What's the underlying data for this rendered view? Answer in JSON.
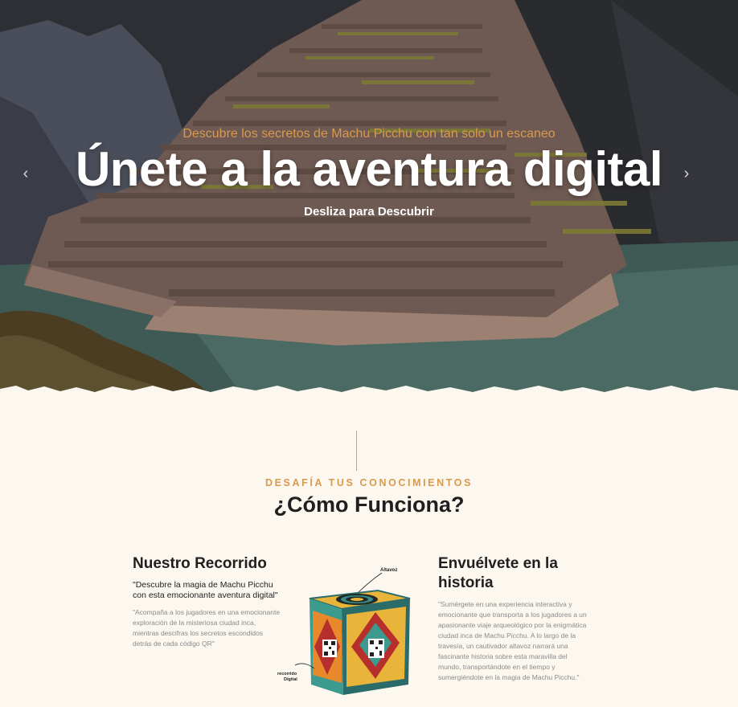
{
  "hero": {
    "subtitle": "Descubre los secretos de Machu Picchu con tan solo un escaneo",
    "title": "Únete a la aventura digital",
    "cta": "Desliza para Descubrir",
    "prev_arrow": "‹",
    "next_arrow": "›"
  },
  "section": {
    "eyebrow": "DESAFÍA TUS CONOCIMIENTOS",
    "title": "¿Cómo Funciona?"
  },
  "left_column": {
    "heading": "Nuestro Recorrido",
    "quote": "\"Descubre la magia de Machu Picchu con esta emocionante aventura digital\"",
    "body": "\"Acompaña a los jugadores en una emocionante exploración de la misteriosa ciudad inca, mientras descifras los secretos escondidos detrás de cada código QR\""
  },
  "right_column": {
    "heading": "Envuélvete en la historia",
    "body": "\"Sumérgete en una experiencia interactiva y emocionante que transporta a los jugadores a un apasionante viaje arqueológico por la enigmática ciudad inca de Machu Picchu. A lo largo de la travesía, un cautivador altavoz narrará una fascinante historia sobre esta maravilla del mundo, transportándote en el tiempo y sumergiéndote en la magia de Machu Picchu.\""
  },
  "cube": {
    "label_speaker": "Altavoz",
    "label_tour_1": "recorrido",
    "label_tour_2": "Digital"
  },
  "colors": {
    "accent": "#d99a4e",
    "cream": "#fcf8f0",
    "dark": "#1f1f1f"
  }
}
